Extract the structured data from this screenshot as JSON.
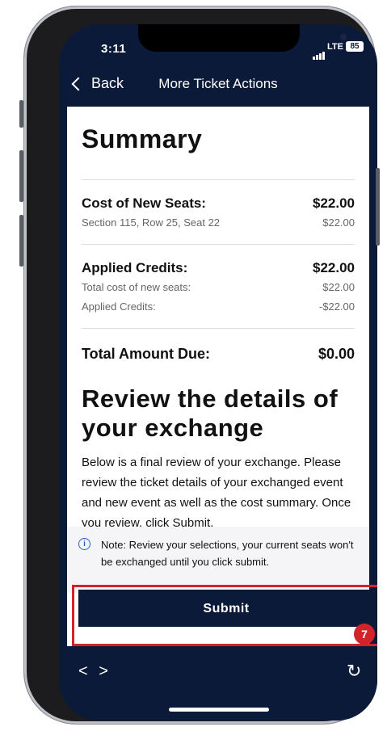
{
  "status": {
    "time": "3:11",
    "network": "LTE",
    "battery": "85"
  },
  "nav": {
    "back_label": "Back",
    "title": "More Ticket Actions"
  },
  "summary": {
    "heading": "Summary",
    "cost_new_seats": {
      "label": "Cost of New Seats:",
      "amount": "$22.00",
      "detail_label": "Section 115, Row 25, Seat 22",
      "detail_amount": "$22.00"
    },
    "applied_credits": {
      "label": "Applied Credits:",
      "amount": "$22.00",
      "lines": [
        {
          "label": "Total cost of new seats:",
          "amount": "$22.00"
        },
        {
          "label": "Applied Credits:",
          "amount": "-$22.00"
        }
      ]
    },
    "total": {
      "label": "Total Amount Due:",
      "amount": "$0.00"
    }
  },
  "review": {
    "heading_line1": "Review the details of",
    "heading_line2": "your exchange",
    "text": "Below is a final review of your exchange. Please review the ticket details of your exchanged event and new event as well as the cost summary. Once you review, click Submit."
  },
  "note": {
    "icon": "info-icon",
    "text": "Note: Review your selections, your current seats won't be exchanged until you click submit."
  },
  "submit_label": "Submit",
  "step_badge": "7",
  "bottom": {
    "nav_arrows": "< >",
    "refresh_icon": "↻"
  },
  "colors": {
    "navy": "#0c1a3a",
    "highlight": "#d2232a",
    "info": "#2b5fbd"
  }
}
